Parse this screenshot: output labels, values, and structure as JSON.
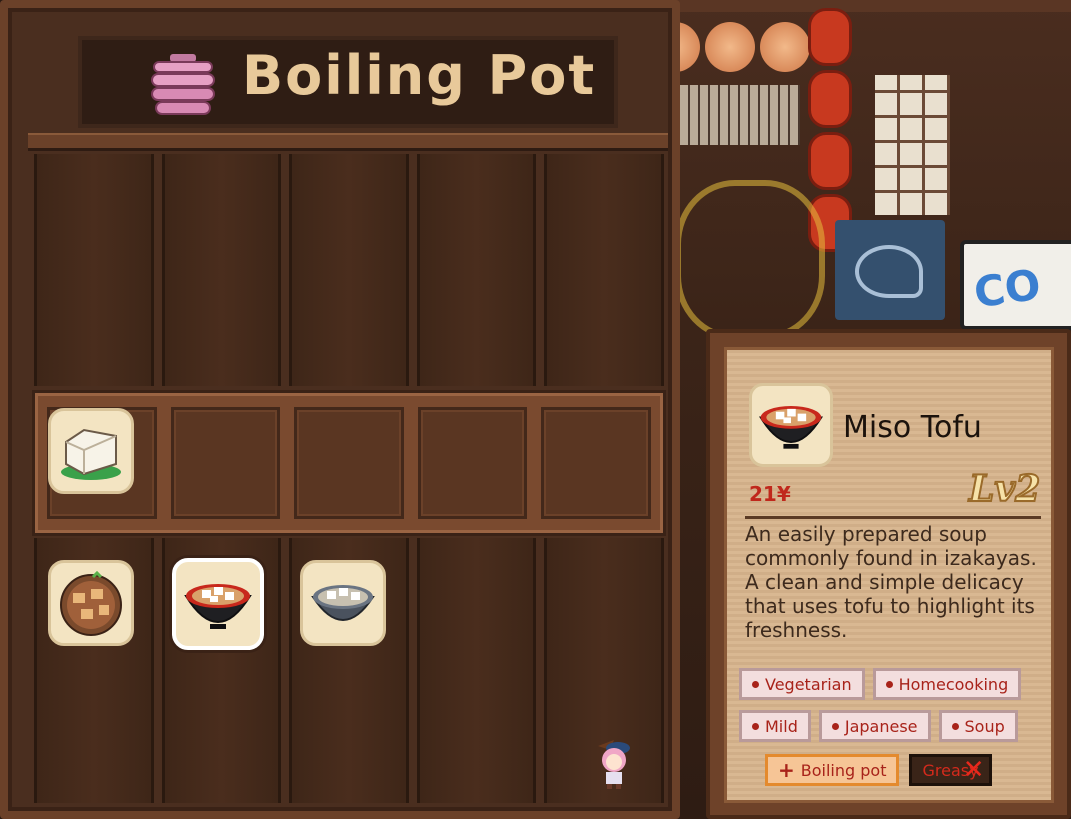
{
  "panel": {
    "title": "Boiling Pot"
  },
  "items_row": [
    {
      "name": "tofu-item"
    }
  ],
  "dishes_row": [
    {
      "name": "braised-tofu-dish"
    },
    {
      "name": "miso-tofu-dish",
      "selected": true
    },
    {
      "name": "tofu-soup-dish"
    }
  ],
  "detail": {
    "name": "Miso Tofu",
    "price": "21¥",
    "level": "Lv2",
    "description": "An easily prepared soup commonly found in izakayas. A clean and simple delicacy that uses tofu to highlight its freshness.",
    "tags_row1": [
      "Vegetarian",
      "Homecooking"
    ],
    "tags_row2": [
      "Mild",
      "Japanese",
      "Soup"
    ],
    "bonus_tag": "Boiling pot",
    "negative_tag": "Greasy"
  },
  "scene": {
    "sign_text": "CO"
  },
  "colors": {
    "panel": "#4a2e1f",
    "card": "#d7b48c",
    "title": "#e8c99a",
    "price": "#c0281c"
  }
}
